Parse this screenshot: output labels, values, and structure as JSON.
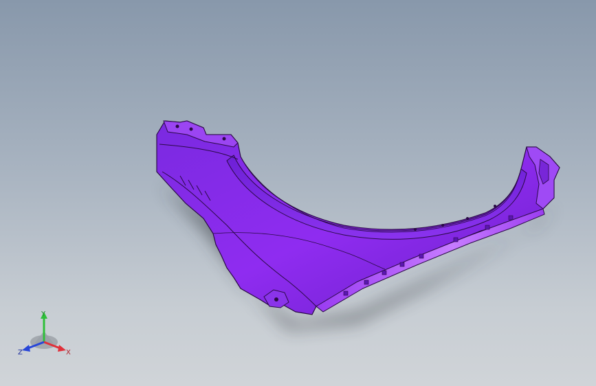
{
  "viewport": {
    "background_top": "#8898ab",
    "background_bottom": "#d0d4d8",
    "model": {
      "part_color": "#8a2be2",
      "part_highlight": "#c27bff",
      "part_shadow_color": "#3a3f48",
      "edge_color": "#2a0a45"
    }
  },
  "triad": {
    "x_label": "X",
    "y_label": "Y",
    "z_label": "Z",
    "x_color": "#e0303a",
    "y_color": "#2fbf3a",
    "z_color": "#2846d8"
  }
}
